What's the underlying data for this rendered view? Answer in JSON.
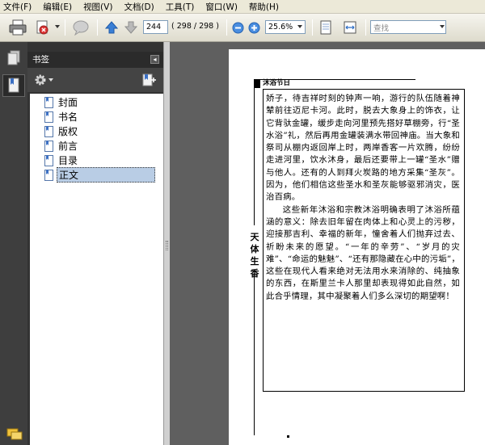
{
  "menu": [
    "文件(F)",
    "编辑(E)",
    "视图(V)",
    "文档(D)",
    "工具(T)",
    "窗口(W)",
    "帮助(H)"
  ],
  "toolbar": {
    "page_current": "244",
    "page_total": "( 298 / 298 )",
    "zoom": "25.6%",
    "search_placeholder": "查找"
  },
  "panel": {
    "title": "书签",
    "bookmarks": [
      "封面",
      "书名",
      "版权",
      "前言",
      "目录",
      "正文"
    ]
  },
  "page": {
    "header": "沐浴节日",
    "side_title": "天体生香",
    "para1": "娇子，待吉祥时刻的钟声一响，游行的队伍随着神辇前往迈尼卡河。此时，脱去大象身上的饰衣，让它背驮金罐，缓步走向河里预先搭好草棚旁，行“圣水浴”礼，然后再用金罐装满水带回神庙。当大象和祭司从棚内返回岸上时，两岸香客一片欢腾，纷纷走进河里，饮水沐身，最后还要带上一罐“圣水”赠与他人。还有的人到拜火炭路的地方采集“圣灰”。因为，他们相信这些圣水和圣灰能够驱邪消灾，医治百病。",
    "para2": "这些新年沐浴和宗教沐浴明确表明了沐浴所蕴涵的意义：除去旧年留在肉体上和心灵上的污秽，迎接那吉利、幸福的新年，憧舍着人们抛弃过去、祈盼未来的愿望。“一年的辛劳”、“岁月的灾难”、“命运的魅魅”、“还有那隐藏在心中的污垢”，这些在现代人看来绝对无法用水来消除的、纯抽象的东西，在斯里兰卡人那里却表现得如此自然，如此合乎情理，其中凝聚着人们多么深切的期望啊！"
  }
}
